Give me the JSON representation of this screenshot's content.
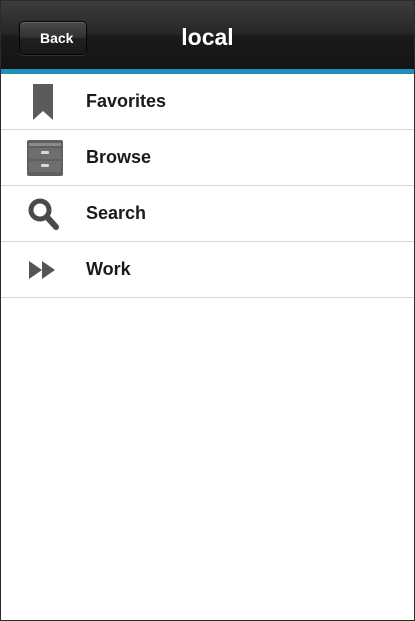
{
  "header": {
    "title": "local",
    "back_label": "Back",
    "accent_color": "#1f8fb7"
  },
  "menu": {
    "items": [
      {
        "label": "Favorites",
        "icon": "bookmark-icon"
      },
      {
        "label": "Browse",
        "icon": "file-cabinet-icon"
      },
      {
        "label": "Search",
        "icon": "magnifier-icon"
      },
      {
        "label": "Work",
        "icon": "fast-forward-icon"
      }
    ]
  }
}
